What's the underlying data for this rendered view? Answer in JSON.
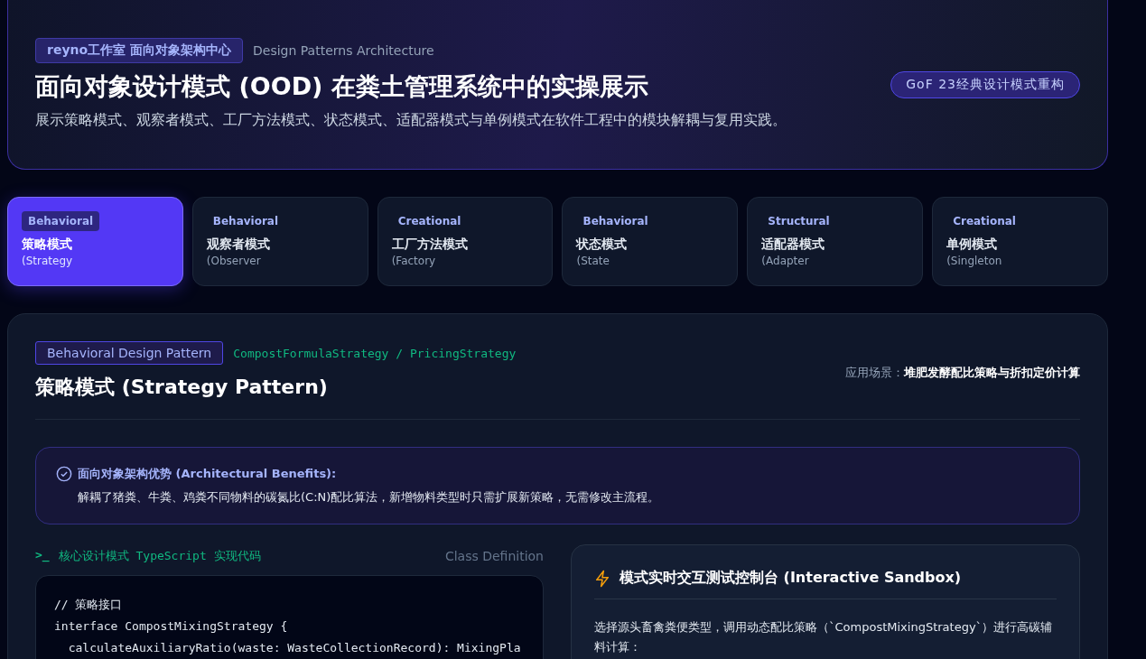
{
  "header": {
    "studio_badge": "reyno工作室 面向对象架构中心",
    "subtitle_en": "Design Patterns Architecture",
    "title": "面向对象设计模式 (OOD) 在粪土管理系统中的实操展示",
    "description": "展示策略模式、观察者模式、工厂方法模式、状态模式、适配器模式与单例模式在软件工程中的模块解耦与复用实践。",
    "gof_badge": "GoF 23经典设计模式重构"
  },
  "pattern_tabs": [
    {
      "category": "Behavioral",
      "name": "策略模式",
      "english": "(Strategy",
      "selected": true
    },
    {
      "category": "Behavioral",
      "name": "观察者模式",
      "english": "(Observer",
      "selected": false
    },
    {
      "category": "Creational",
      "name": "工厂方法模式",
      "english": "(Factory",
      "selected": false
    },
    {
      "category": "Behavioral",
      "name": "状态模式",
      "english": "(State",
      "selected": false
    },
    {
      "category": "Structural",
      "name": "适配器模式",
      "english": "(Adapter",
      "selected": false
    },
    {
      "category": "Creational",
      "name": "单例模式",
      "english": "(Singleton",
      "selected": false
    }
  ],
  "detail": {
    "pattern_badge": "Behavioral Design Pattern",
    "classes": "CompostFormulaStrategy / PricingStrategy",
    "title": "策略模式 (Strategy Pattern)",
    "scenario_label": "应用场景：",
    "scenario": "堆肥发酵配比策略与折扣定价计算",
    "benefits": {
      "title": "面向对象架构优势 (Architectural Benefits):",
      "text": "解耦了猪粪、牛粪、鸡粪不同物料的碳氮比(C:N)配比算法，新增物料类型时只需扩展新策略，无需修改主流程。"
    },
    "code": {
      "prompt": ">_",
      "title": "核心设计模式 TypeScript 实现代码",
      "tag": "Class Definition",
      "lines": [
        "// 策略接口",
        "interface CompostMixingStrategy {",
        "  calculateAuxiliaryRatio(waste: WasteCollectionRecord): MixingPla"
      ]
    },
    "sandbox": {
      "title": "模式实时交互测试控制台 (Interactive Sandbox)",
      "text": "选择源头畜禽粪便类型，调用动态配比策略（`CompostMixingStrategy`）进行高碳辅料计算："
    }
  }
}
